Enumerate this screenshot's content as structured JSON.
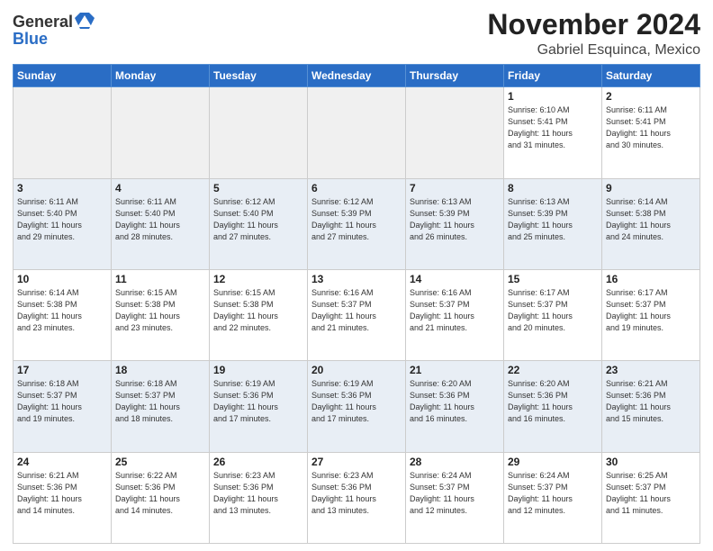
{
  "header": {
    "logo_general": "General",
    "logo_blue": "Blue",
    "month_title": "November 2024",
    "location": "Gabriel Esquinca, Mexico"
  },
  "days_of_week": [
    "Sunday",
    "Monday",
    "Tuesday",
    "Wednesday",
    "Thursday",
    "Friday",
    "Saturday"
  ],
  "weeks": [
    [
      {
        "day": "",
        "info": ""
      },
      {
        "day": "",
        "info": ""
      },
      {
        "day": "",
        "info": ""
      },
      {
        "day": "",
        "info": ""
      },
      {
        "day": "",
        "info": ""
      },
      {
        "day": "1",
        "info": "Sunrise: 6:10 AM\nSunset: 5:41 PM\nDaylight: 11 hours\nand 31 minutes."
      },
      {
        "day": "2",
        "info": "Sunrise: 6:11 AM\nSunset: 5:41 PM\nDaylight: 11 hours\nand 30 minutes."
      }
    ],
    [
      {
        "day": "3",
        "info": "Sunrise: 6:11 AM\nSunset: 5:40 PM\nDaylight: 11 hours\nand 29 minutes."
      },
      {
        "day": "4",
        "info": "Sunrise: 6:11 AM\nSunset: 5:40 PM\nDaylight: 11 hours\nand 28 minutes."
      },
      {
        "day": "5",
        "info": "Sunrise: 6:12 AM\nSunset: 5:40 PM\nDaylight: 11 hours\nand 27 minutes."
      },
      {
        "day": "6",
        "info": "Sunrise: 6:12 AM\nSunset: 5:39 PM\nDaylight: 11 hours\nand 27 minutes."
      },
      {
        "day": "7",
        "info": "Sunrise: 6:13 AM\nSunset: 5:39 PM\nDaylight: 11 hours\nand 26 minutes."
      },
      {
        "day": "8",
        "info": "Sunrise: 6:13 AM\nSunset: 5:39 PM\nDaylight: 11 hours\nand 25 minutes."
      },
      {
        "day": "9",
        "info": "Sunrise: 6:14 AM\nSunset: 5:38 PM\nDaylight: 11 hours\nand 24 minutes."
      }
    ],
    [
      {
        "day": "10",
        "info": "Sunrise: 6:14 AM\nSunset: 5:38 PM\nDaylight: 11 hours\nand 23 minutes."
      },
      {
        "day": "11",
        "info": "Sunrise: 6:15 AM\nSunset: 5:38 PM\nDaylight: 11 hours\nand 23 minutes."
      },
      {
        "day": "12",
        "info": "Sunrise: 6:15 AM\nSunset: 5:38 PM\nDaylight: 11 hours\nand 22 minutes."
      },
      {
        "day": "13",
        "info": "Sunrise: 6:16 AM\nSunset: 5:37 PM\nDaylight: 11 hours\nand 21 minutes."
      },
      {
        "day": "14",
        "info": "Sunrise: 6:16 AM\nSunset: 5:37 PM\nDaylight: 11 hours\nand 21 minutes."
      },
      {
        "day": "15",
        "info": "Sunrise: 6:17 AM\nSunset: 5:37 PM\nDaylight: 11 hours\nand 20 minutes."
      },
      {
        "day": "16",
        "info": "Sunrise: 6:17 AM\nSunset: 5:37 PM\nDaylight: 11 hours\nand 19 minutes."
      }
    ],
    [
      {
        "day": "17",
        "info": "Sunrise: 6:18 AM\nSunset: 5:37 PM\nDaylight: 11 hours\nand 19 minutes."
      },
      {
        "day": "18",
        "info": "Sunrise: 6:18 AM\nSunset: 5:37 PM\nDaylight: 11 hours\nand 18 minutes."
      },
      {
        "day": "19",
        "info": "Sunrise: 6:19 AM\nSunset: 5:36 PM\nDaylight: 11 hours\nand 17 minutes."
      },
      {
        "day": "20",
        "info": "Sunrise: 6:19 AM\nSunset: 5:36 PM\nDaylight: 11 hours\nand 17 minutes."
      },
      {
        "day": "21",
        "info": "Sunrise: 6:20 AM\nSunset: 5:36 PM\nDaylight: 11 hours\nand 16 minutes."
      },
      {
        "day": "22",
        "info": "Sunrise: 6:20 AM\nSunset: 5:36 PM\nDaylight: 11 hours\nand 16 minutes."
      },
      {
        "day": "23",
        "info": "Sunrise: 6:21 AM\nSunset: 5:36 PM\nDaylight: 11 hours\nand 15 minutes."
      }
    ],
    [
      {
        "day": "24",
        "info": "Sunrise: 6:21 AM\nSunset: 5:36 PM\nDaylight: 11 hours\nand 14 minutes."
      },
      {
        "day": "25",
        "info": "Sunrise: 6:22 AM\nSunset: 5:36 PM\nDaylight: 11 hours\nand 14 minutes."
      },
      {
        "day": "26",
        "info": "Sunrise: 6:23 AM\nSunset: 5:36 PM\nDaylight: 11 hours\nand 13 minutes."
      },
      {
        "day": "27",
        "info": "Sunrise: 6:23 AM\nSunset: 5:36 PM\nDaylight: 11 hours\nand 13 minutes."
      },
      {
        "day": "28",
        "info": "Sunrise: 6:24 AM\nSunset: 5:37 PM\nDaylight: 11 hours\nand 12 minutes."
      },
      {
        "day": "29",
        "info": "Sunrise: 6:24 AM\nSunset: 5:37 PM\nDaylight: 11 hours\nand 12 minutes."
      },
      {
        "day": "30",
        "info": "Sunrise: 6:25 AM\nSunset: 5:37 PM\nDaylight: 11 hours\nand 11 minutes."
      }
    ]
  ]
}
